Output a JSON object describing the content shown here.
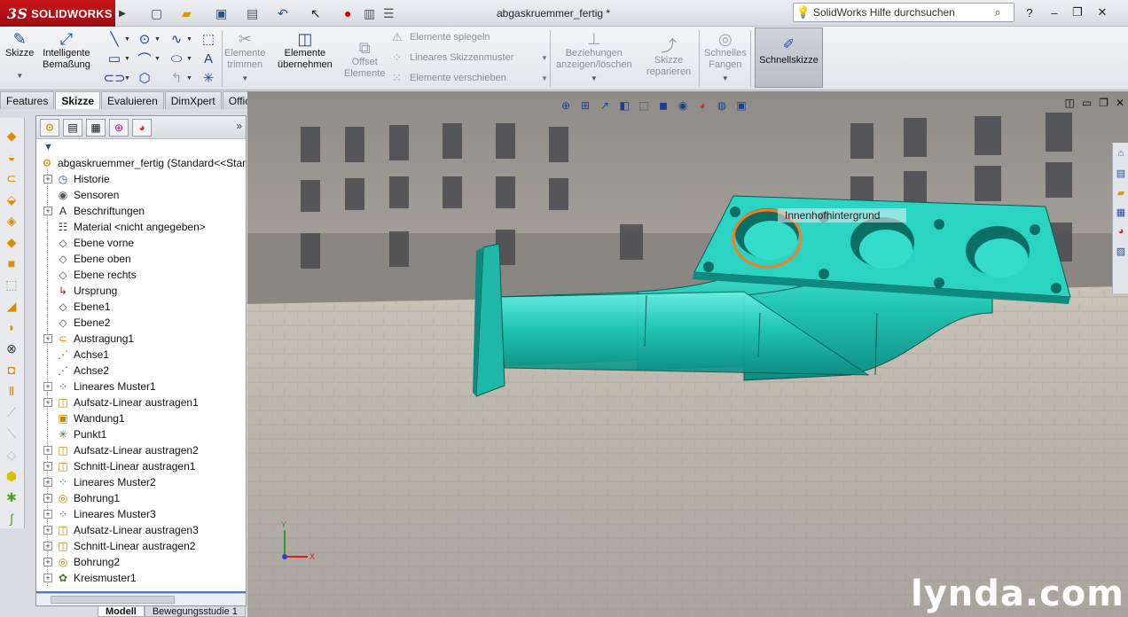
{
  "app": {
    "logo_text": "SOLIDWORKS",
    "logo_prefix": "3S",
    "document_title": "abgaskruemmer_fertig *",
    "help_search_placeholder": "SolidWorks Hilfe durchsuchen"
  },
  "toolbar": {
    "skizze": "Skizze",
    "intelligente_bemassung": [
      "Intelligente",
      "Bemaßung"
    ],
    "elemente_trimmen": [
      "Elemente",
      "trimmen"
    ],
    "elemente_uebernehmen": [
      "Elemente",
      "übernehmen"
    ],
    "offset_elemente": [
      "Offset",
      "Elemente"
    ],
    "elemente_spiegeln": "Elemente spiegeln",
    "lineares_skizzenmuster": "Lineares Skizzenmuster",
    "elemente_verschieben": "Elemente verschieben",
    "beziehungen": [
      "Beziehungen",
      "anzeigen/löschen"
    ],
    "skizze_reparieren": [
      "Skizze",
      "reparieren"
    ],
    "schnelles_fangen": [
      "Schnelles",
      "Fangen"
    ],
    "schnellskizze": "Schnellskizze"
  },
  "tabs": [
    "Features",
    "Skizze",
    "Evaluieren",
    "DimXpert",
    "Office Produkte"
  ],
  "active_tab": "Skizze",
  "feature_tree": {
    "root": "abgaskruemmer_fertig  (Standard<<Standard>",
    "items": [
      {
        "label": "Historie",
        "expandable": true,
        "icon": "history-icon"
      },
      {
        "label": "Sensoren",
        "expandable": false,
        "icon": "sensor-icon"
      },
      {
        "label": "Beschriftungen",
        "expandable": true,
        "icon": "annotations-icon"
      },
      {
        "label": "Material <nicht angegeben>",
        "expandable": false,
        "icon": "material-icon"
      },
      {
        "label": "Ebene vorne",
        "expandable": false,
        "icon": "plane-icon"
      },
      {
        "label": "Ebene oben",
        "expandable": false,
        "icon": "plane-icon"
      },
      {
        "label": "Ebene rechts",
        "expandable": false,
        "icon": "plane-icon"
      },
      {
        "label": "Ursprung",
        "expandable": false,
        "icon": "origin-icon"
      },
      {
        "label": "Ebene1",
        "expandable": false,
        "icon": "plane-icon"
      },
      {
        "label": "Ebene2",
        "expandable": false,
        "icon": "plane-icon"
      },
      {
        "label": "Austragung1",
        "expandable": true,
        "icon": "sweep-icon"
      },
      {
        "label": "Achse1",
        "expandable": false,
        "icon": "axis-icon"
      },
      {
        "label": "Achse2",
        "expandable": false,
        "icon": "axis-icon"
      },
      {
        "label": "Lineares Muster1",
        "expandable": true,
        "icon": "pattern-icon"
      },
      {
        "label": "Aufsatz-Linear austragen1",
        "expandable": true,
        "icon": "extrude-icon"
      },
      {
        "label": "Wandung1",
        "expandable": false,
        "icon": "shell-icon"
      },
      {
        "label": "Punkt1",
        "expandable": false,
        "icon": "point-icon"
      },
      {
        "label": "Aufsatz-Linear austragen2",
        "expandable": true,
        "icon": "extrude-icon"
      },
      {
        "label": "Schnitt-Linear austragen1",
        "expandable": true,
        "icon": "cut-icon"
      },
      {
        "label": "Lineares Muster2",
        "expandable": true,
        "icon": "pattern-icon"
      },
      {
        "label": "Bohrung1",
        "expandable": true,
        "icon": "hole-icon"
      },
      {
        "label": "Lineares Muster3",
        "expandable": true,
        "icon": "pattern-icon"
      },
      {
        "label": "Aufsatz-Linear austragen3",
        "expandable": true,
        "icon": "extrude-icon"
      },
      {
        "label": "Schnitt-Linear austragen2",
        "expandable": true,
        "icon": "cut-icon"
      },
      {
        "label": "Bohrung2",
        "expandable": true,
        "icon": "hole-icon"
      },
      {
        "label": "Kreismuster1",
        "expandable": true,
        "icon": "circular-pattern-icon"
      }
    ]
  },
  "bottom_tabs": [
    "Modell",
    "Bewegungsstudie 1"
  ],
  "viewport": {
    "tooltip": "Innenhofhintergrund",
    "watermark": "lynda.com",
    "triad_x": "X",
    "triad_y": "Y",
    "model_color": "#1fc2b4"
  }
}
